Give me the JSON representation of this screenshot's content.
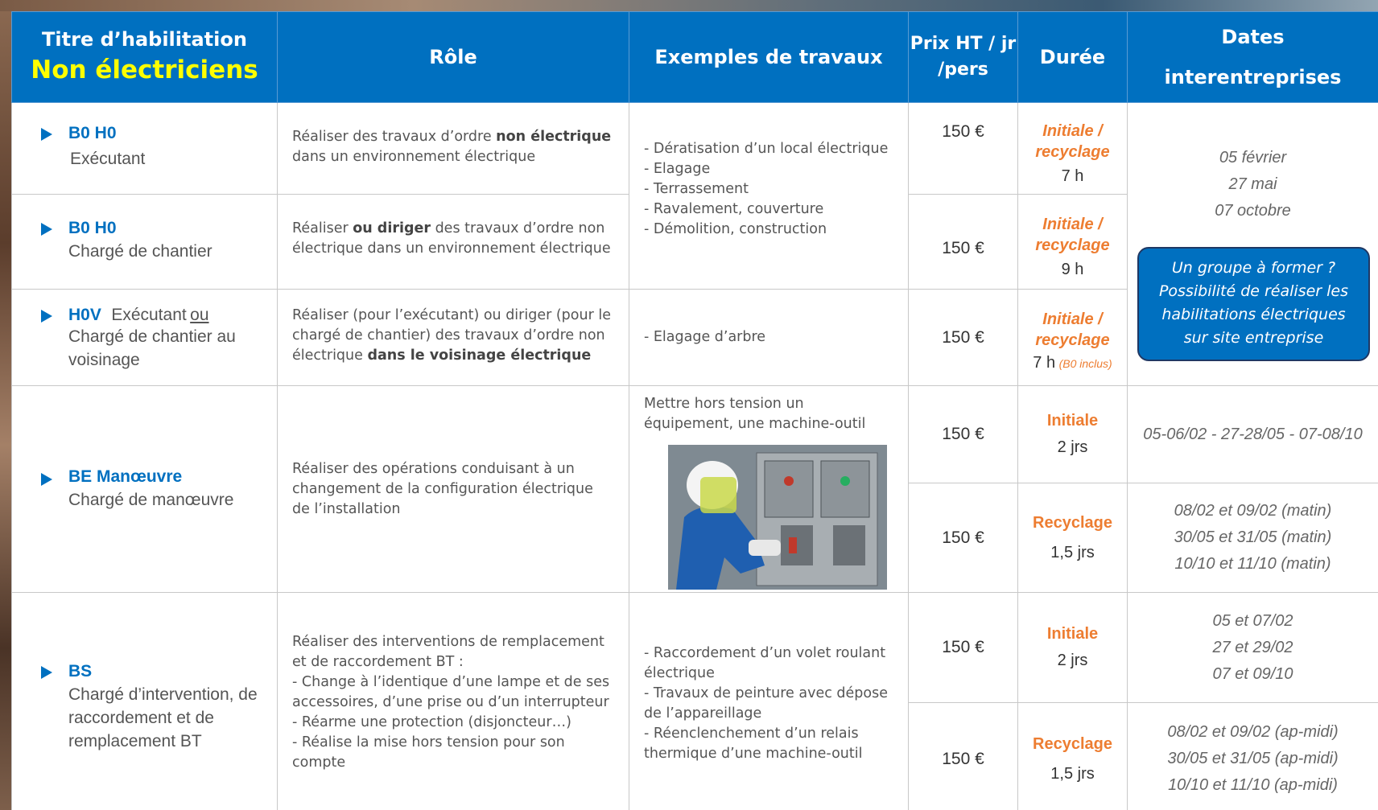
{
  "header": {
    "col1_title": "Titre d’habilitation",
    "col1_subtitle": "Non électriciens",
    "col2": "Rôle",
    "col3": "Exemples de travaux",
    "col4_line1": "Prix HT / jr",
    "col4_line2": "/pers",
    "col5": "Durée",
    "col6_line1": "Dates",
    "col6_line2": "interentreprises"
  },
  "rows": {
    "b0h0_exec": {
      "code": "B0 H0",
      "sub": "Exécutant",
      "role_a": "Réaliser des travaux d’ordre ",
      "role_b": "non électrique",
      "role_c": " dans un environnement électrique",
      "price": "150 €",
      "dur_l1": "Initiale /",
      "dur_l2": "recyclage",
      "dur_time": "7 h"
    },
    "b0h0_chef": {
      "code": "B0 H0",
      "sub": "Chargé de chantier",
      "role_a": "Réaliser ",
      "role_b": "ou diriger",
      "role_c": " des travaux d’ordre non électrique dans un environnement électrique",
      "price": "150 €",
      "dur_l1": "Initiale /",
      "dur_l2": "recyclage",
      "dur_time": "9 h"
    },
    "b0h0_examples": [
      "- Dératisation d’un local électrique",
      "- Elagage",
      "- Terrassement",
      "- Ravalement, couverture",
      "- Démolition, construction"
    ],
    "h0v": {
      "code": "H0V",
      "sub_a": "Exécutant",
      "sub_or": "ou",
      "sub_b1": "Chargé de chantier au",
      "sub_b2": "voisinage",
      "role_a": "Réaliser (pour l’exécutant) ou diriger (pour le chargé de chantier) des travaux d’ordre non électrique ",
      "role_b": "dans le voisinage électrique",
      "example": "- Elagage d’arbre",
      "price": "150 €",
      "dur_l1": "Initiale /",
      "dur_l2": "recyclage",
      "dur_time": "7 h",
      "dur_note": "(B0  inclus)"
    },
    "be": {
      "code": "BE Manœuvre",
      "sub": "Chargé de manœuvre",
      "role": "Réaliser des opérations conduisant à un changement de la configuration électrique de l’installation",
      "example": "Mettre hors tension un équipement, une machine-outil",
      "initial_price": "150 €",
      "initial_label": "Initiale",
      "initial_time": "2 jrs",
      "initial_dates": "05-06/02 - 27-28/05 - 07-08/10",
      "recy_price": "150 €",
      "recy_label": "Recyclage",
      "recy_time": "1,5 jrs",
      "recy_dates": [
        "08/02 et 09/02 (matin)",
        "30/05 et 31/05 (matin)",
        "10/10 et 11/10 (matin)"
      ]
    },
    "bs": {
      "code": "BS",
      "sub": [
        "Chargé d’intervention, de",
        "raccordement et de",
        "remplacement BT"
      ],
      "role": [
        "Réaliser des interventions de remplacement et de raccordement BT :",
        "- Change à l’identique d’une lampe et de ses accessoires, d’une prise ou d’un interrupteur",
        "- Réarme une protection (disjoncteur…)",
        "- Réalise la mise hors tension pour son compte"
      ],
      "examples": [
        "- Raccordement d’un volet roulant électrique",
        "- Travaux de peinture avec dépose de l’appareillage",
        "- Réenclenchement d’un relais thermique d’une machine-outil"
      ],
      "initial_price": "150 €",
      "initial_label": "Initiale",
      "initial_time": "2 jrs",
      "initial_dates": [
        "05 et 07/02",
        "27 et 29/02",
        "07 et 09/10"
      ],
      "recy_price": "150 €",
      "recy_label": "Recyclage",
      "recy_time": "1,5 jrs",
      "recy_dates": [
        "08/02 et 09/02 (ap-midi)",
        "30/05 et 31/05 (ap-midi)",
        "10/10 et 11/10 (ap-midi)"
      ]
    }
  },
  "b0_dates": [
    "05 février",
    "27 mai",
    "07 octobre"
  ],
  "callout": [
    "Un groupe à former ?",
    "Possibilité de réaliser les",
    "habilitations électriques",
    "sur site entreprise"
  ],
  "colors": {
    "header_blue": "#0070c0",
    "accent_orange": "#ed7d31",
    "highlight_yellow": "#ffff00"
  }
}
